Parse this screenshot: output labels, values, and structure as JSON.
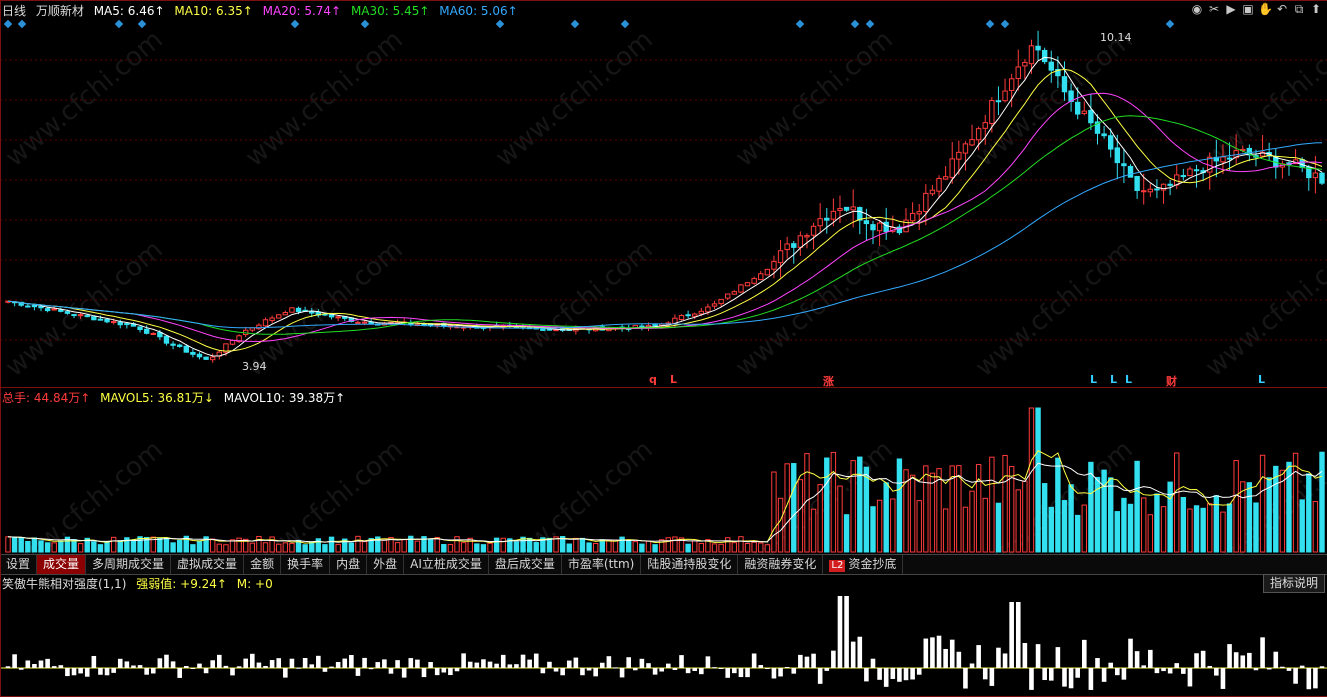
{
  "main_header": {
    "period": "日线",
    "stock_name": "万顺新材",
    "ma5": "MA5: 6.46↑",
    "ma10": "MA10: 6.35↑",
    "ma20": "MA20: 5.74↑",
    "ma30": "MA30: 5.45↑",
    "ma60": "MA60: 5.06↑"
  },
  "colors": {
    "up": "#ff3b3b",
    "down": "#33e0f0",
    "ma5": "#ffffff",
    "ma10": "#ffff44",
    "ma20": "#ff44ff",
    "ma30": "#22dd22",
    "ma60": "#33aaff",
    "background": "#000000"
  },
  "price_annotations": {
    "high": "10.14",
    "low": "3.94"
  },
  "signals": [
    "q",
    "L",
    "涨",
    "L",
    "L",
    "L",
    "财",
    "L"
  ],
  "toolbar_icons": [
    "eye-icon",
    "scissors-icon",
    "play-icon",
    "bookmark-icon",
    "hand-icon",
    "undo-icon",
    "restore-icon",
    "pin-icon"
  ],
  "volume_header": {
    "total": "总手: 44.84万↑",
    "mavol5": "MAVOL5: 36.81万↓",
    "mavol10": "MAVOL10: 39.38万↑"
  },
  "tabs": [
    "设置",
    "成交量",
    "多周期成交量",
    "虚拟成交量",
    "金额",
    "换手率",
    "内盘",
    "外盘",
    "AI立桩成交量",
    "盘后成交量",
    "市盈率(ttm)",
    "陆股通持股变化",
    "融资融券变化",
    "资金抄底"
  ],
  "active_tab": "成交量",
  "tab_badge": "L2",
  "indicator_header": {
    "name": "笑傲牛熊相对强度(1,1)",
    "strength": "强弱值: +9.24↑",
    "m": "M: +0"
  },
  "help_button": "指标说明",
  "watermark": "www.cfchi.com"
}
